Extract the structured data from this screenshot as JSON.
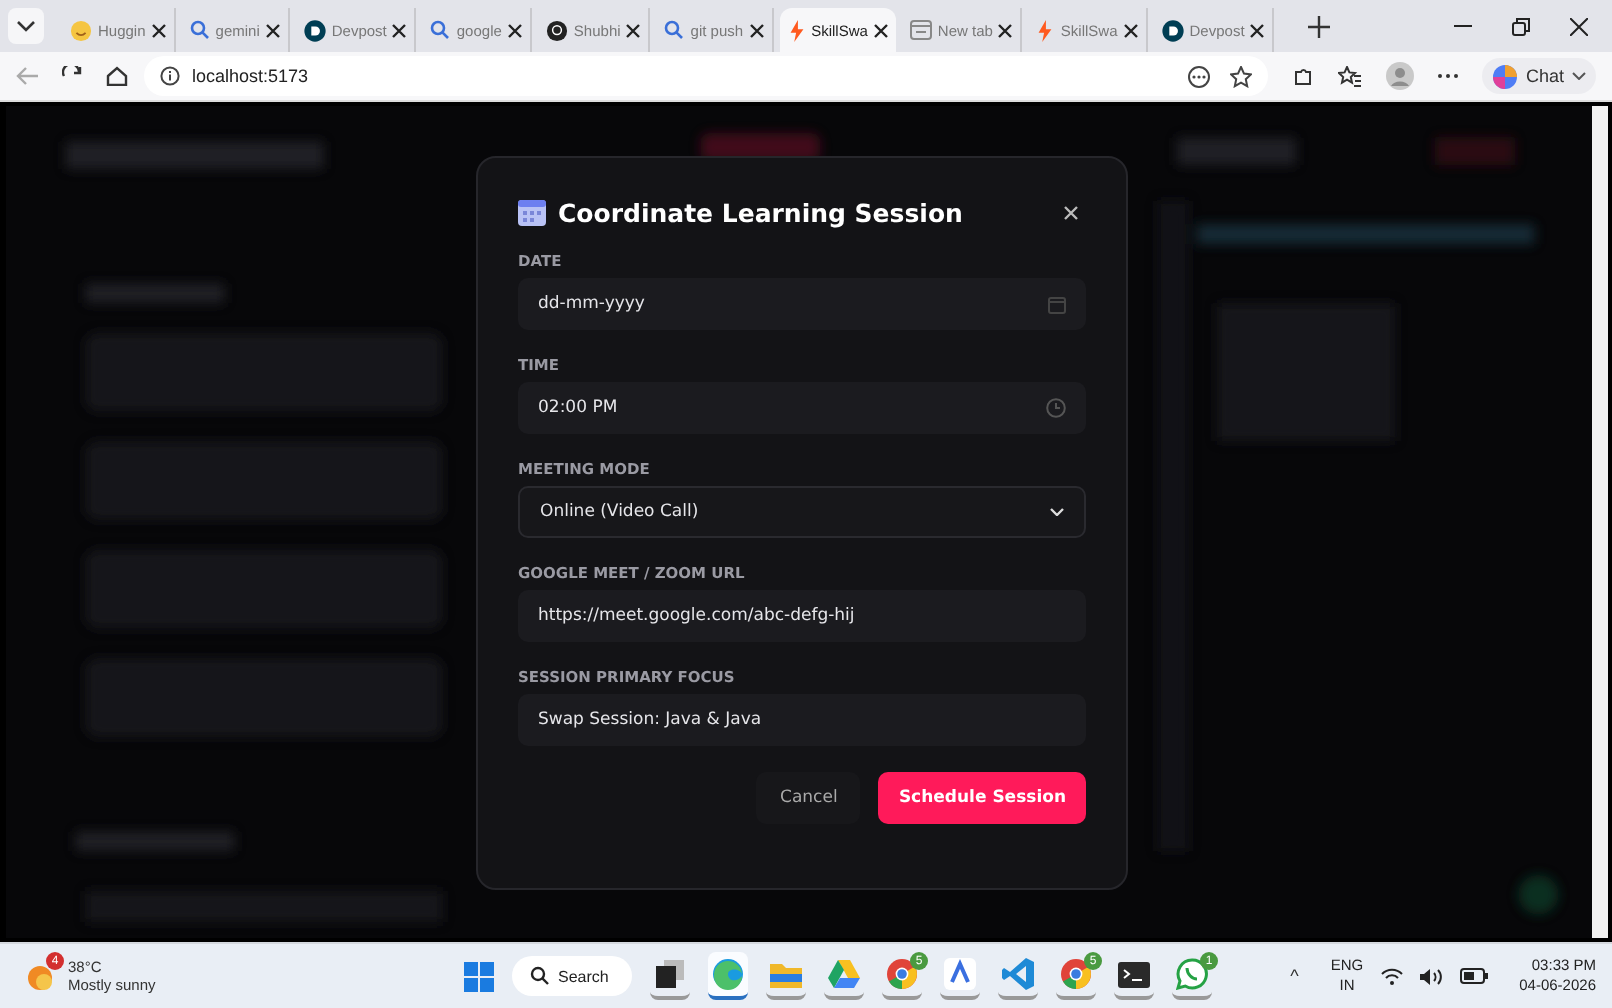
{
  "browser": {
    "tabs": [
      {
        "title": "Huggin",
        "kind": "hug",
        "selected": false
      },
      {
        "title": "gemini",
        "kind": "search",
        "selected": false
      },
      {
        "title": "Devpost",
        "kind": "devpost",
        "selected": false
      },
      {
        "title": "google",
        "kind": "search",
        "selected": false
      },
      {
        "title": "Shubhi",
        "kind": "github",
        "selected": false
      },
      {
        "title": "git push",
        "kind": "search",
        "selected": false
      },
      {
        "title": "SkillSwa",
        "kind": "spark",
        "selected": true
      },
      {
        "title": "New tab",
        "kind": "newtab",
        "selected": false
      },
      {
        "title": "SkillSwa",
        "kind": "spark",
        "selected": false
      },
      {
        "title": "Devpost",
        "kind": "devpost",
        "selected": false
      }
    ],
    "address": "localhost:5173",
    "chat_label": "Chat"
  },
  "modal": {
    "title": "Coordinate Learning Session",
    "fields": [
      {
        "label": "DATE",
        "kind": "date",
        "placeholder": "dd-mm-yyyy"
      },
      {
        "label": "TIME",
        "kind": "time",
        "value": "02:00 PM"
      },
      {
        "label": "MEETING MODE",
        "kind": "select",
        "value": "Online (Video Call)"
      },
      {
        "label": "GOOGLE MEET / ZOOM URL",
        "kind": "text",
        "value": "https://meet.google.com/abc-defg-hij"
      },
      {
        "label": "SESSION PRIMARY FOCUS",
        "kind": "text",
        "value": "Swap Session: Java & Java"
      }
    ],
    "cancel_label": "Cancel",
    "submit_label": "Schedule Session"
  },
  "taskbar": {
    "weather": {
      "badge": "4",
      "temperature": "38°C",
      "condition": "Mostly sunny"
    },
    "search_label": "Search",
    "apps": [
      {
        "kind": "taskview",
        "selected": false
      },
      {
        "kind": "edge",
        "selected": true
      },
      {
        "kind": "folder",
        "selected": false
      },
      {
        "kind": "drive",
        "selected": false
      },
      {
        "kind": "chrome",
        "badge": "5",
        "selected": false
      },
      {
        "kind": "arc",
        "selected": false
      },
      {
        "kind": "vscode",
        "selected": false
      },
      {
        "kind": "chrome",
        "badge": "5",
        "selected": false
      },
      {
        "kind": "terminal",
        "selected": false
      },
      {
        "kind": "whatsapp",
        "badge": "1",
        "selected": false
      }
    ],
    "tray_caret": "^",
    "language": "ENG",
    "region": "IN",
    "time": "03:33 PM",
    "date": "04-06-2026"
  }
}
